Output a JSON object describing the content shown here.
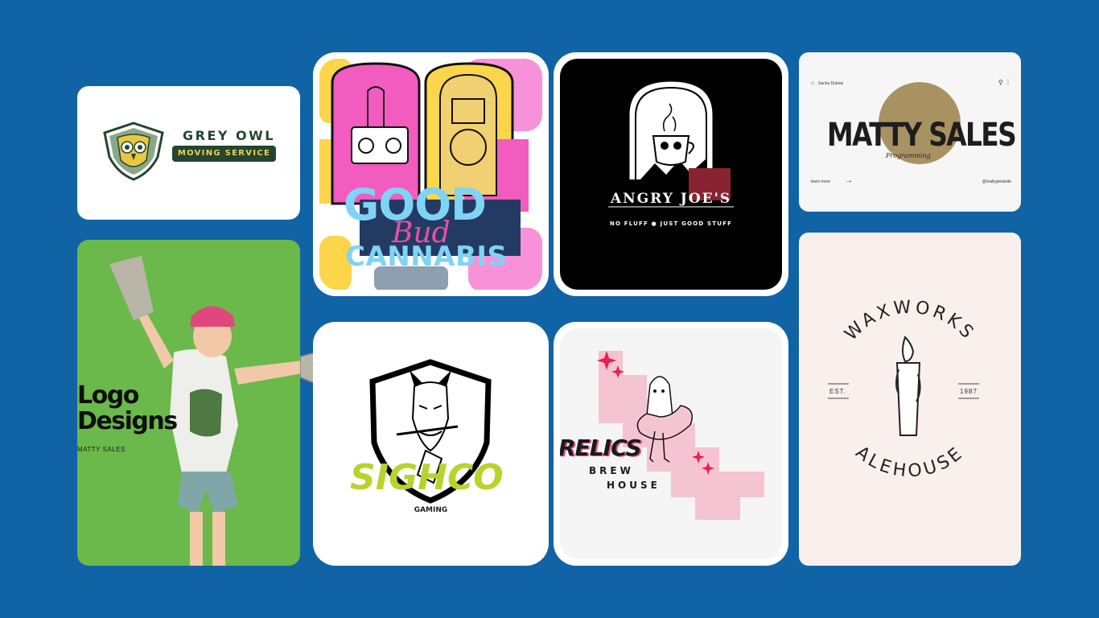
{
  "cards": {
    "grey_owl": {
      "title": "GREY OWL",
      "badge": "MOVING SERVICE"
    },
    "logo_designs": {
      "title_line1": "Logo",
      "title_line2": "Designs",
      "subtitle": "MATTY SALES"
    },
    "good_bud": {
      "word1": "GOOD",
      "word2": "Bud",
      "word3": "CANNABIS"
    },
    "angry_joe": {
      "title": "ANGRY JOE'S",
      "tagline": "NO FLUFF ● JUST GOOD STUFF"
    },
    "matty_sales": {
      "author": "Sacha Dubois",
      "title": "MATTY SALES",
      "script": "Programming",
      "learn_more": "learn more",
      "handle": "@reallygreatsite"
    },
    "sighco": {
      "title": "SIGHCO",
      "subtitle": "GAMING"
    },
    "relics": {
      "title": "RELICS",
      "line2": "BREW",
      "line3": "HOUSE"
    },
    "waxworks": {
      "top_arc": "WAXWORKS",
      "bottom_arc": "ALEHOUSE",
      "est": "EST.",
      "year": "1987"
    }
  },
  "colors": {
    "background": "#1064a6",
    "grey_owl_green": "#24452e",
    "grey_owl_yellow": "#e8d35a",
    "logo_designs_green": "#6bb84b",
    "good_bud_pink": "#f25cbf",
    "good_bud_blue": "#7fd3f4",
    "matty_gold": "#a99262",
    "sighco_lime": "#b8d42c",
    "relics_pink": "#f4c4d2",
    "waxworks_bg": "#f9f0ed"
  }
}
